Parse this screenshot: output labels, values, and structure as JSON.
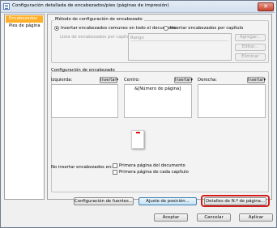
{
  "window": {
    "title": "Configuración detallada de encabezados/pies (páginas de impresión)",
    "close_glyph": "✕"
  },
  "nav": {
    "items": [
      {
        "label": "Encabezados",
        "selected": true
      },
      {
        "label": "Pies de página",
        "selected": false
      }
    ]
  },
  "method": {
    "title": "Método de configuración de encabezado",
    "option_common": "Insertar encabezados comunes en todo el documento",
    "option_per_chapter": "Insertar encabezados por capítulo",
    "selected": "option_common",
    "chapter_list_label": "Lista de encabezados por capítulo:",
    "column_range": "Rango",
    "add_label": "Agregar...",
    "edit_label": "Editar...",
    "delete_label": "Eliminar"
  },
  "header_config": {
    "title": "Configuración de encabezado",
    "left_label": "Izquierda:",
    "center_label": "Centro:",
    "right_label": "Derecha:",
    "insert_label": "Insertar▾",
    "left_text": "",
    "center_text": "&[Número de página]",
    "right_text": ""
  },
  "no_insert": {
    "label": "No insertar encabezados en:",
    "first_page_document": "Primera página del documento",
    "first_page_chapter": "Primera página de cada capítulo",
    "first_page_document_checked": false,
    "first_page_chapter_checked": false
  },
  "buttons": {
    "font_settings": "Configuración de fuentes...",
    "position_adjust": "Ajuste de posición...",
    "page_number_details": "Detalles de N.º de página...",
    "accept": "Aceptar",
    "cancel": "Cancelar",
    "apply": "Aplicar"
  },
  "colors": {
    "selected_nav": "#ffb028",
    "highlight": "#d31c1c",
    "page_marker": "#e01010"
  }
}
